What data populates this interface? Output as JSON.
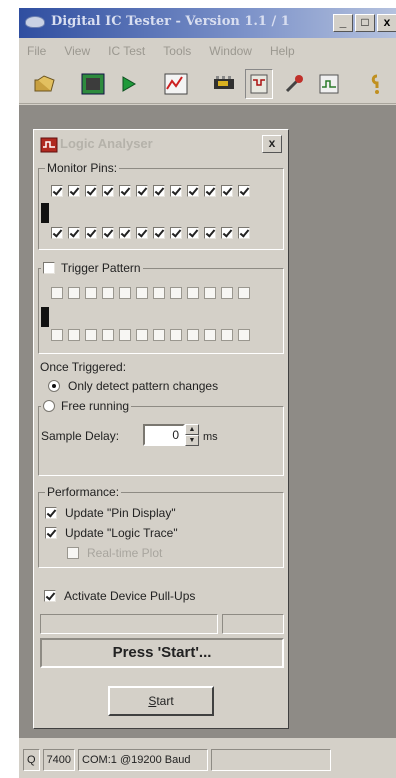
{
  "app": {
    "title": "Digital IC Tester - Version 1.1 / 1",
    "window_buttons": [
      "_",
      "□",
      "x"
    ]
  },
  "menu": [
    "File",
    "View",
    "IC Test",
    "Tools",
    "Window",
    "Help"
  ],
  "toolbar": {
    "icons": [
      "open-icon",
      "chip-icon",
      "play-icon",
      "chart-icon",
      "chip-test-icon",
      "logic-analyser-icon",
      "probe-icon",
      "trace-icon",
      "help-icon"
    ]
  },
  "child_window": {
    "title": "Logic Analyser",
    "close": "x",
    "monitor_pins": {
      "label": "Monitor Pins:",
      "top_row_checked": 12,
      "bottom_row_checked": 12
    },
    "trigger_pattern": {
      "label": "Trigger Pattern",
      "checked": false
    },
    "once_triggered": {
      "label": "Once Triggered:",
      "option_detect": "Only detect pattern changes",
      "option_free": "Free running",
      "selected": "Only detect pattern changes",
      "sample_delay_label": "Sample Delay:",
      "sample_delay_value": "0",
      "sample_delay_unit": "ms"
    },
    "performance": {
      "label": "Performance:",
      "update_pin_display": "Update \"Pin Display\"",
      "update_logic_trace": "Update \"Logic Trace\"",
      "realtime_plot": "Real-time Plot"
    },
    "pull_ups": "Activate Device Pull-Ups",
    "status_message": "Press 'Start'...",
    "start_button": {
      "prefix": "",
      "underlined": "S",
      "rest": "tart"
    }
  },
  "statusbar": {
    "cell1": "Q",
    "cell2": "7400",
    "cell3": "COM:1 @19200 Baud"
  }
}
